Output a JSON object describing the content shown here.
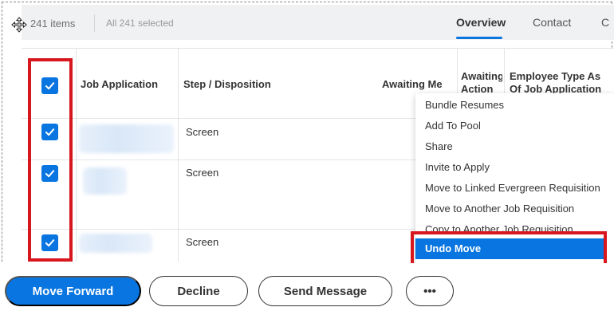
{
  "toolbar": {
    "items_count": "241 items",
    "selection_status": "All 241 selected",
    "tabs": [
      {
        "label": "Overview",
        "active": true
      },
      {
        "label": "Contact",
        "active": false
      },
      {
        "label": "C",
        "active": false
      }
    ]
  },
  "table": {
    "headers": {
      "job_application": "Job Application",
      "step_disposition": "Step / Disposition",
      "awaiting_me": "Awaiting Me",
      "awaiting_action": "Awaiting Action",
      "employee_type": "Employee Type As Of Job Application Date"
    },
    "rows": [
      {
        "selected": true,
        "applicant": "",
        "step": "Screen"
      },
      {
        "selected": true,
        "applicant": "",
        "step": "Screen"
      },
      {
        "selected": true,
        "applicant": "",
        "step": "Screen"
      }
    ]
  },
  "context_menu": {
    "items": [
      "Bundle Resumes",
      "Add To Pool",
      "Share",
      "Invite to Apply",
      "Move to Linked Evergreen Requisition",
      "Move to Another Job Requisition",
      "Copy to Another Job Requisition",
      "Undo Move"
    ],
    "highlighted": "Undo Move"
  },
  "actions": {
    "move_forward": "Move Forward",
    "decline": "Decline",
    "send_message": "Send Message",
    "more": "•••"
  },
  "colors": {
    "accent": "#0875e1",
    "highlight_outline": "#d8161d"
  }
}
